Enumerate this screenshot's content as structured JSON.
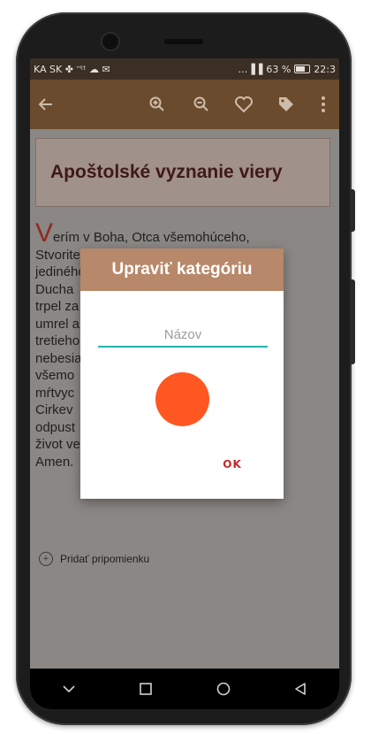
{
  "statusbar": {
    "left": "KA SK ✤ ᵔᵗᵗ ☁ ✉",
    "signal": "…▐▐",
    "battery_pct": "63 %",
    "time": "22:3"
  },
  "appbar": {
    "back_icon": "arrow-left-icon",
    "zoom_in_icon": "zoom-in-icon",
    "zoom_out_icon": "zoom-out-icon",
    "favorite_icon": "heart-icon",
    "tag_icon": "tag-icon",
    "more_icon": "more-vert-icon"
  },
  "article": {
    "title": "Apoštolské vyznanie viery",
    "dropcap": "V",
    "lines": [
      "erím v Boha, Otca všemohúceho,",
      "Stvorite                                  , jeho",
      "jediného                                   čal z",
      "Ducha",
      "trpel za                                 aný,",
      "umrel a                                 ulým,",
      "tretieho",
      "nebesia",
      "všemo                                  i",
      "mŕtvyc                                  ú",
      "Cirkev                                   h, v",
      "odpust                                 a a v",
      "život ve",
      "Amen."
    ],
    "reminder_label": "Pridať pripomienku"
  },
  "dialog": {
    "title": "Upraviť kategóriu",
    "input_placeholder": "Názov",
    "swatch_color": "#ff5722",
    "ok_label": "OK"
  },
  "navbar": {
    "down_icon": "chevron-down-icon",
    "recents_icon": "square-icon",
    "home_icon": "circle-icon",
    "back_icon": "triangle-back-icon"
  },
  "colors": {
    "appbar": "#6b4b2d",
    "dialog_header": "#b8886a",
    "accent_line": "#26b3a9",
    "ok_text": "#c62828"
  }
}
